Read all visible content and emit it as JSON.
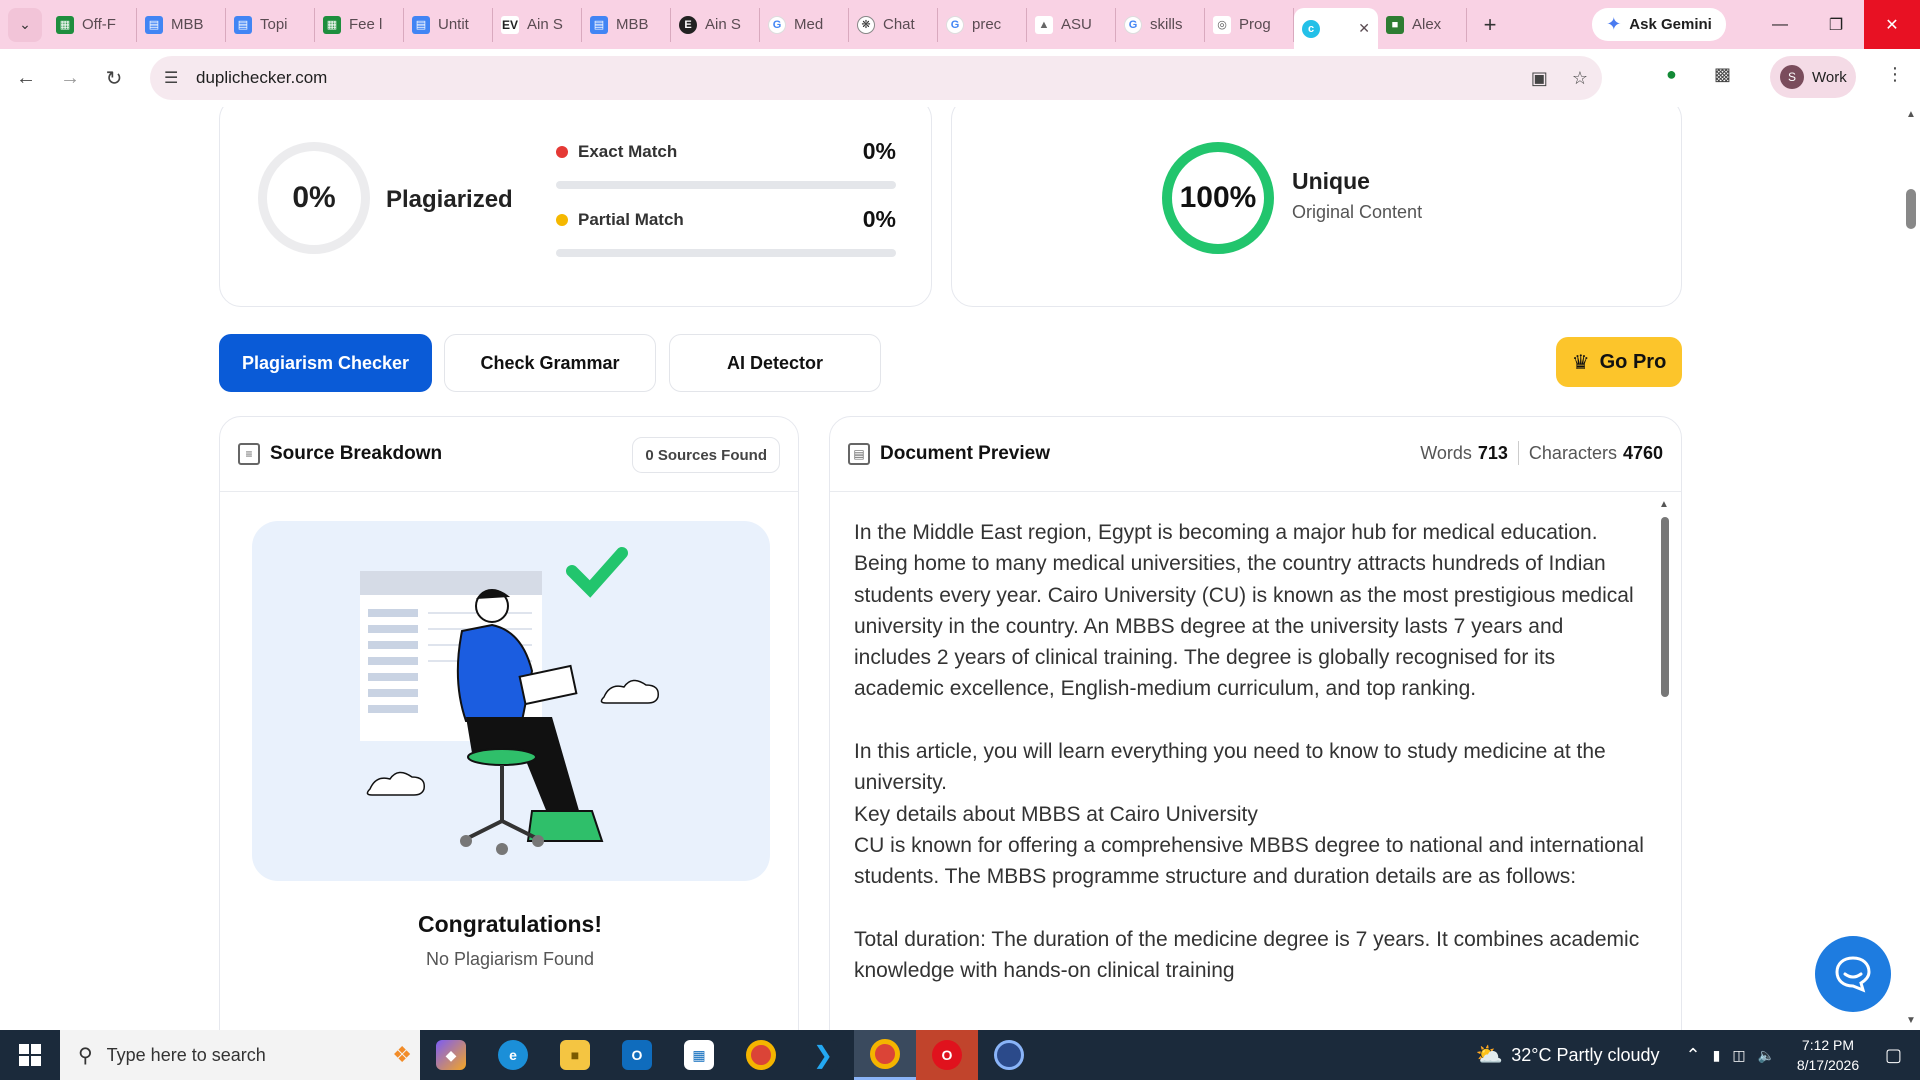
{
  "browser": {
    "tabs": [
      {
        "label": "Off-F",
        "icon": "sheets-icon"
      },
      {
        "label": "MBB",
        "icon": "docs-icon"
      },
      {
        "label": "Topi",
        "icon": "docs-icon"
      },
      {
        "label": "Fee l",
        "icon": "sheets-icon"
      },
      {
        "label": "Untit",
        "icon": "docs-icon"
      },
      {
        "label": "Ain S",
        "icon": "ev-icon"
      },
      {
        "label": "MBB",
        "icon": "docs-icon"
      },
      {
        "label": "Ain S",
        "icon": "e-icon"
      },
      {
        "label": "Med",
        "icon": "google-icon"
      },
      {
        "label": "Chat",
        "icon": "chatgpt-icon"
      },
      {
        "label": "prec",
        "icon": "google-icon"
      },
      {
        "label": "ASU",
        "icon": "asu-icon"
      },
      {
        "label": "skills",
        "icon": "google-icon"
      },
      {
        "label": "Prog",
        "icon": "prog-icon"
      },
      {
        "label": "Alex",
        "icon": "alex-icon"
      }
    ],
    "gemini_label": "Ask Gemini",
    "url": "duplichecker.com",
    "profile_initial": "S",
    "profile_label": "Work"
  },
  "summary": {
    "plagiarized_pct": "0%",
    "plagiarized_label": "Plagiarized",
    "exact_label": "Exact Match",
    "exact_pct": "0%",
    "partial_label": "Partial Match",
    "partial_pct": "0%",
    "unique_pct": "100%",
    "unique_label": "Unique",
    "unique_sub": "Original Content",
    "colors": {
      "exact": "#e53935",
      "partial": "#f5b800",
      "unique": "#22c56d"
    }
  },
  "tools": {
    "plagiarism": "Plagiarism Checker",
    "grammar": "Check Grammar",
    "ai": "AI Detector",
    "gopro": "Go Pro"
  },
  "sources": {
    "title": "Source Breakdown",
    "badge": "0 Sources Found",
    "congrats": "Congratulations!",
    "no_plag": "No Plagiarism Found"
  },
  "document": {
    "title": "Document Preview",
    "words_label": "Words",
    "words": "713",
    "chars_label": "Characters",
    "chars": "4760",
    "para1": "In the Middle East region, Egypt is becoming a major hub for medical education. Being home to many medical universities, the country attracts hundreds of Indian students every year.  Cairo University (CU) is known as the most prestigious medical university in the country. An MBBS degree at the university lasts 7 years and includes 2 years of clinical training. The degree is globally recognised for its academic excellence, English-medium curriculum, and top ranking.",
    "para2": "In this article, you will learn everything you need to know to study medicine at the university.",
    "para3": "Key details about MBBS at Cairo University",
    "para4": "CU is known for offering a comprehensive MBBS degree to national and international students. The MBBS programme structure and duration details are as follows:",
    "para5": "Total duration: The duration of the medicine degree is 7 years. It combines academic knowledge with hands-on clinical training"
  },
  "taskbar": {
    "search_placeholder": "Type here to search",
    "weather": "32°C  Partly cloudy",
    "time": "7:12 PM",
    "date": "8/17/2026"
  }
}
